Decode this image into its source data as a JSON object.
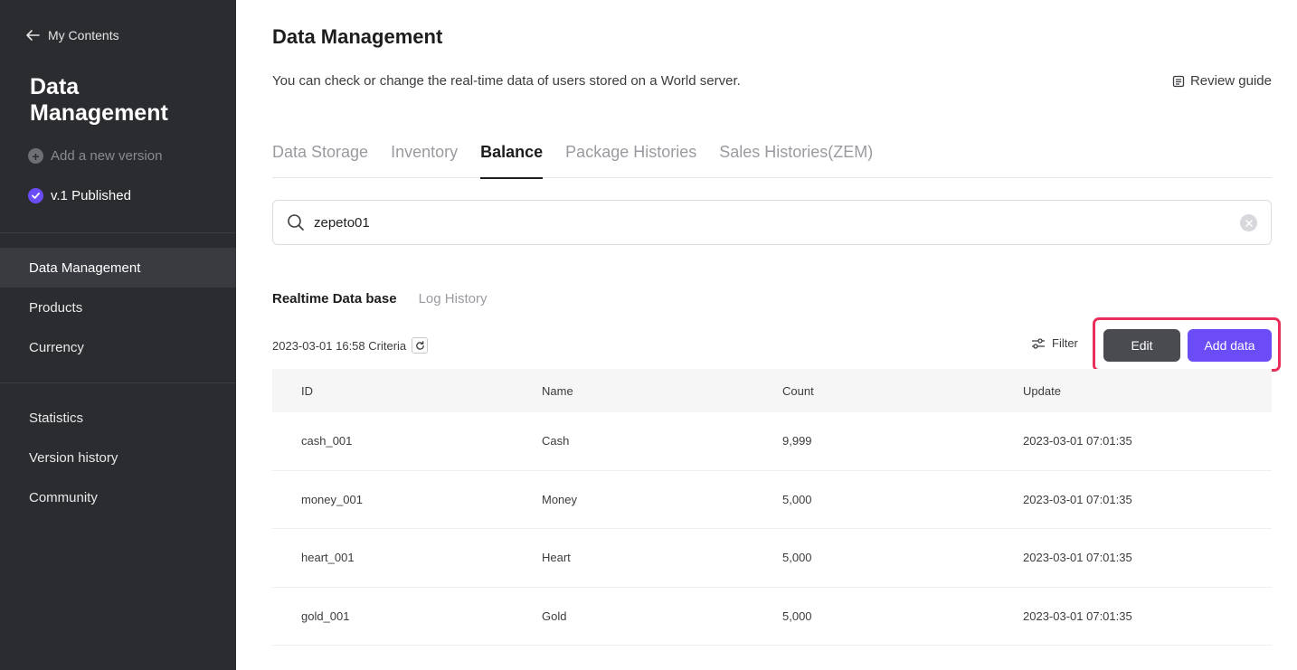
{
  "sidebar": {
    "back_label": "My Contents",
    "title": "Data Management",
    "add_version_label": "Add a new version",
    "published_label": "v.1 Published",
    "nav_primary": [
      "Data Management",
      "Products",
      "Currency"
    ],
    "nav_secondary": [
      "Statistics",
      "Version history",
      "Community"
    ],
    "active_item": "Data Management"
  },
  "main": {
    "title": "Data Management",
    "description": "You can check or change the real-time data of users stored on a World server.",
    "review_guide_label": "Review guide",
    "tabs": [
      "Data Storage",
      "Inventory",
      "Balance",
      "Package Histories",
      "Sales Histories(ZEM)"
    ],
    "active_tab": "Balance",
    "search": {
      "value": "zepeto01",
      "placeholder": ""
    },
    "subtabs": [
      "Realtime Data base",
      "Log History"
    ],
    "active_subtab": "Realtime Data base",
    "criteria_label": "2023-03-01 16:58 Criteria",
    "filter_label": "Filter",
    "edit_label": "Edit",
    "add_label": "Add data",
    "table": {
      "headers": [
        "ID",
        "Name",
        "Count",
        "Update"
      ],
      "rows": [
        [
          "cash_001",
          "Cash",
          "9,999",
          "2023-03-01 07:01:35"
        ],
        [
          "money_001",
          "Money",
          "5,000",
          "2023-03-01 07:01:35"
        ],
        [
          "heart_001",
          "Heart",
          "5,000",
          "2023-03-01 07:01:35"
        ],
        [
          "gold_001",
          "Gold",
          "5,000",
          "2023-03-01 07:01:35"
        ]
      ]
    }
  },
  "colors": {
    "sidebar_bg": "#2b2c30",
    "accent": "#6b4cf6",
    "highlight": "#e8305c"
  }
}
